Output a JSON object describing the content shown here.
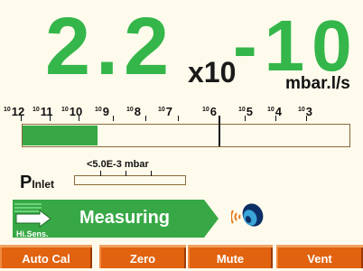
{
  "reading": {
    "mantissa": "2.2",
    "multiplier": "x10",
    "exponent": "-10",
    "unit": "mbar.l/s"
  },
  "scale": {
    "labels": [
      {
        "prefix": "10",
        "exp": "12"
      },
      {
        "prefix": "10",
        "exp": "11"
      },
      {
        "prefix": "10",
        "exp": "10"
      },
      {
        "prefix": "10",
        "exp": "9"
      },
      {
        "prefix": "10",
        "exp": "8"
      },
      {
        "prefix": "10",
        "exp": "7"
      },
      {
        "prefix": "10",
        "exp": "6"
      },
      {
        "prefix": "10",
        "exp": "5"
      },
      {
        "prefix": "10",
        "exp": "4"
      },
      {
        "prefix": "10",
        "exp": "3"
      }
    ],
    "fill_fraction": 0.23,
    "marker_fraction": 0.6,
    "fill_color": "#37a845"
  },
  "pressure": {
    "label": "P",
    "sublabel": "Inlet",
    "value": "<5.0E-3 mbar"
  },
  "status": {
    "text": "Measuring",
    "mode": "Hi.Sens.",
    "mode_icon": "arrow-right-icon",
    "speaker_icon": "speaker-icon",
    "color": "#37a845"
  },
  "softkeys": [
    "Auto Cal",
    "Zero",
    "Mute",
    "Vent"
  ],
  "colors": {
    "reading": "#35b64a",
    "background": "#fffbec",
    "softkey": "#e1620f"
  }
}
